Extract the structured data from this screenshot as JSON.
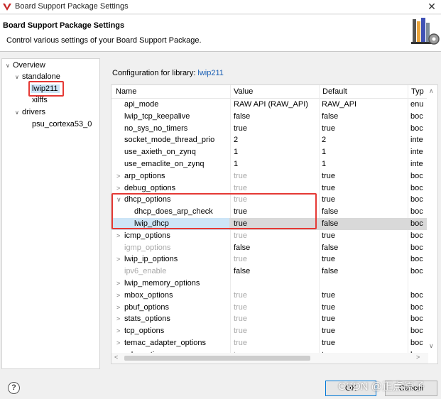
{
  "window": {
    "title": "Board Support Package Settings",
    "close_glyph": "✕"
  },
  "header": {
    "title": "Board Support Package Settings",
    "description": "Control various settings of your Board Support Package."
  },
  "tree": {
    "items": [
      {
        "label": "Overview",
        "twisty": "∨"
      },
      {
        "label": "standalone",
        "twisty": "∨"
      },
      {
        "label": "lwip211",
        "twisty": ""
      },
      {
        "label": "xilffs",
        "twisty": ""
      },
      {
        "label": "drivers",
        "twisty": "∨"
      },
      {
        "label": "psu_cortexa53_0",
        "twisty": ""
      }
    ]
  },
  "config": {
    "label": "Configuration for library:",
    "library": "lwip211"
  },
  "table": {
    "columns": [
      "Name",
      "Value",
      "Default",
      "Typ"
    ],
    "rows": [
      {
        "name": "api_mode",
        "value": "RAW API (RAW_API)",
        "default": "RAW_API",
        "type": "enu",
        "twisty": ""
      },
      {
        "name": "lwip_tcp_keepalive",
        "value": "false",
        "default": "false",
        "type": "boc",
        "twisty": ""
      },
      {
        "name": "no_sys_no_timers",
        "value": "true",
        "default": "true",
        "type": "boc",
        "twisty": ""
      },
      {
        "name": "socket_mode_thread_prio",
        "value": "2",
        "default": "2",
        "type": "inte",
        "twisty": ""
      },
      {
        "name": "use_axieth_on_zynq",
        "value": "1",
        "default": "1",
        "type": "inte",
        "twisty": ""
      },
      {
        "name": "use_emaclite_on_zynq",
        "value": "1",
        "default": "1",
        "type": "inte",
        "twisty": ""
      },
      {
        "name": "arp_options",
        "value": "true",
        "default": "true",
        "type": "boc",
        "twisty": ">"
      },
      {
        "name": "debug_options",
        "value": "true",
        "default": "true",
        "type": "boc",
        "twisty": ">"
      },
      {
        "name": "dhcp_options",
        "value": "true",
        "default": "true",
        "type": "boc",
        "twisty": "∨"
      },
      {
        "name": "dhcp_does_arp_check",
        "value": "true",
        "default": "false",
        "type": "boc",
        "twisty": ""
      },
      {
        "name": "lwip_dhcp",
        "value": "true",
        "default": "false",
        "type": "boc",
        "twisty": ""
      },
      {
        "name": "icmp_options",
        "value": "true",
        "default": "true",
        "type": "boc",
        "twisty": ">"
      },
      {
        "name": "igmp_options",
        "value": "false",
        "default": "false",
        "type": "boc",
        "twisty": ""
      },
      {
        "name": "lwip_ip_options",
        "value": "true",
        "default": "true",
        "type": "boc",
        "twisty": ">"
      },
      {
        "name": "ipv6_enable",
        "value": "false",
        "default": "false",
        "type": "boc",
        "twisty": ""
      },
      {
        "name": "lwip_memory_options",
        "value": "",
        "default": "",
        "type": "",
        "twisty": ">"
      },
      {
        "name": "mbox_options",
        "value": "true",
        "default": "true",
        "type": "boc",
        "twisty": ">"
      },
      {
        "name": "pbuf_options",
        "value": "true",
        "default": "true",
        "type": "boc",
        "twisty": ">"
      },
      {
        "name": "stats_options",
        "value": "true",
        "default": "true",
        "type": "boc",
        "twisty": ">"
      },
      {
        "name": "tcp_options",
        "value": "true",
        "default": "true",
        "type": "boc",
        "twisty": ">"
      },
      {
        "name": "temac_adapter_options",
        "value": "true",
        "default": "true",
        "type": "boc",
        "twisty": ">"
      },
      {
        "name": "udp_options",
        "value": "true",
        "default": "true",
        "type": "boc",
        "twisty": ">"
      }
    ]
  },
  "footer": {
    "help_glyph": "?",
    "ok_label": "OK",
    "cancel_label": "Cancel",
    "watermark": "CSDN @正点原子"
  },
  "colors": {
    "highlight_box": "#e53935",
    "selection": "#cde5f7",
    "link": "#1a5fb4"
  }
}
